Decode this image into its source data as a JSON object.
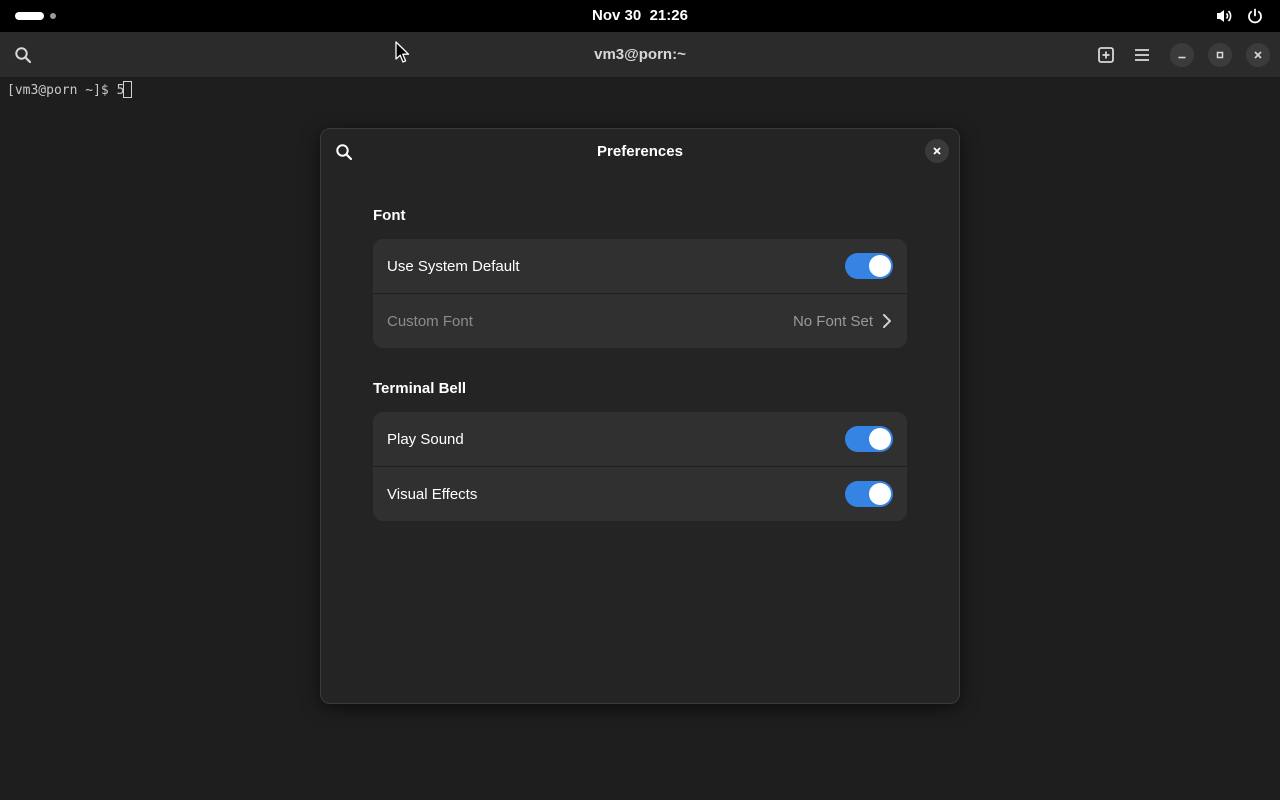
{
  "topbar": {
    "date": "Nov 30",
    "time": "21:26",
    "volume_icon": "speaker-icon",
    "power_icon": "power-icon"
  },
  "terminal": {
    "title": "vm3@porn:~",
    "prompt": "[vm3@porn ~]$ 5"
  },
  "preferences": {
    "title": "Preferences",
    "font_section": {
      "title": "Font",
      "use_system_default": {
        "label": "Use System Default",
        "enabled": true
      },
      "custom_font": {
        "label": "Custom Font",
        "value": "No Font Set"
      }
    },
    "bell_section": {
      "title": "Terminal Bell",
      "play_sound": {
        "label": "Play Sound",
        "enabled": true
      },
      "visual_effects": {
        "label": "Visual Effects",
        "enabled": true
      }
    }
  },
  "colors": {
    "accent": "#3584e4",
    "background": "#1e1e1e",
    "dialog": "#242424",
    "row": "#303030"
  }
}
